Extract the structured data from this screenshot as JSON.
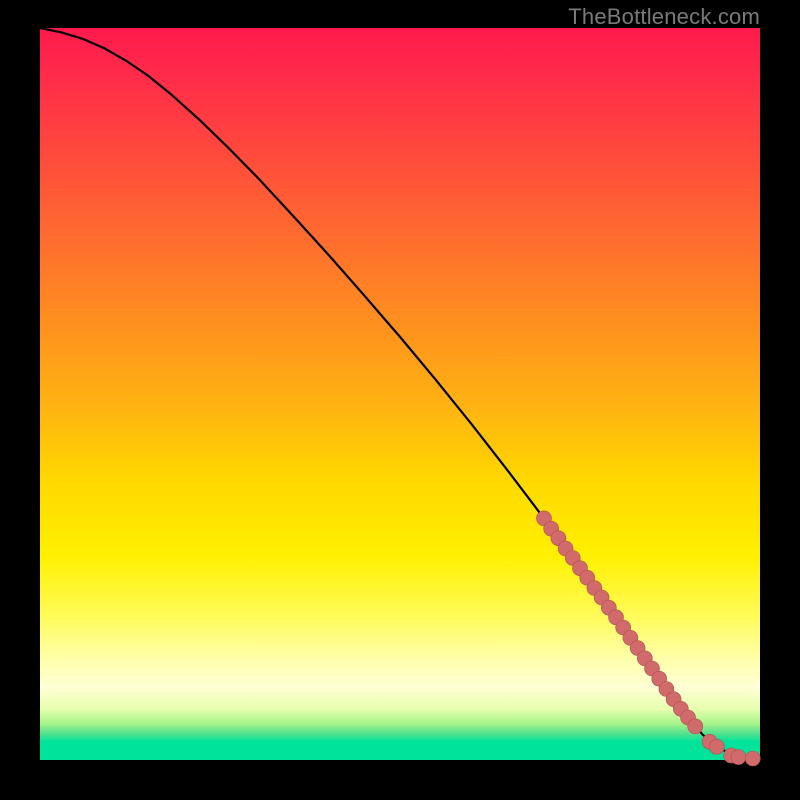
{
  "watermark": "TheBottleneck.com",
  "colors": {
    "point_fill": "#d16a6a",
    "point_stroke": "#b35050",
    "curve": "#000000"
  },
  "chart_data": {
    "type": "line",
    "title": "",
    "xlabel": "",
    "ylabel": "",
    "xlim": [
      0,
      100
    ],
    "ylim": [
      0,
      100
    ],
    "grid": false,
    "legend": false,
    "series": [
      {
        "name": "curve",
        "kind": "line",
        "x": [
          0,
          3,
          6,
          9,
          12,
          15,
          18,
          22,
          26,
          30,
          35,
          40,
          45,
          50,
          55,
          60,
          65,
          70,
          74,
          78,
          82,
          85,
          88,
          90,
          92,
          94,
          96,
          98,
          100
        ],
        "y": [
          100,
          99.4,
          98.5,
          97.2,
          95.5,
          93.5,
          91.1,
          87.6,
          83.8,
          79.8,
          74.5,
          69.1,
          63.5,
          57.8,
          51.9,
          45.8,
          39.5,
          33.0,
          27.6,
          22.2,
          16.7,
          12.5,
          8.4,
          5.8,
          3.5,
          1.8,
          0.8,
          0.2,
          0.1
        ]
      },
      {
        "name": "points",
        "kind": "scatter",
        "x": [
          70,
          71,
          72,
          73,
          74,
          75,
          76,
          77,
          78,
          79,
          80,
          81,
          82,
          83,
          84,
          85,
          86,
          87,
          88,
          89,
          90,
          91,
          93,
          94,
          96,
          97,
          99
        ],
        "y": [
          33.0,
          31.6,
          30.3,
          28.9,
          27.6,
          26.2,
          24.9,
          23.5,
          22.2,
          20.8,
          19.5,
          18.1,
          16.7,
          15.3,
          13.9,
          12.5,
          11.1,
          9.7,
          8.3,
          7.0,
          5.8,
          4.6,
          2.5,
          1.8,
          0.6,
          0.4,
          0.2
        ]
      }
    ]
  }
}
